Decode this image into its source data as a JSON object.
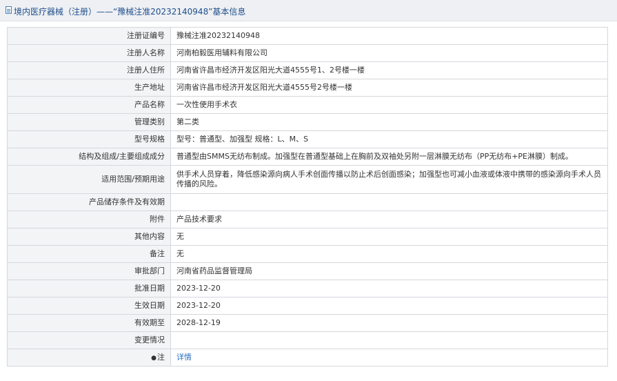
{
  "header": {
    "title": "境内医疗器械（注册）——“豫械注准20232140948”基本信息"
  },
  "rows": [
    {
      "label": "注册证编号",
      "value": "豫械注准20232140948"
    },
    {
      "label": "注册人名称",
      "value": "河南柏毅医用辅料有限公司"
    },
    {
      "label": "注册人住所",
      "value": "河南省许昌市经济开发区阳光大道4555号1、2号楼一楼"
    },
    {
      "label": "生产地址",
      "value": "河南省许昌市经济开发区阳光大道4555号2号楼一楼"
    },
    {
      "label": "产品名称",
      "value": "一次性使用手术衣"
    },
    {
      "label": "管理类别",
      "value": "第二类"
    },
    {
      "label": "型号规格",
      "value": "型号：普通型、加强型 规格：L、M、S"
    },
    {
      "label": "结构及组成/主要组成成分",
      "value": "普通型由SMMS无纺布制成。加强型在普通型基础上在胸前及双袖处另附一层淋膜无纺布（PP无纺布+PE淋膜）制成。"
    },
    {
      "label": "适用范围/预期用途",
      "value": "供手术人员穿着，降低感染源向病人手术创面传播以防止术后创面感染；加强型也可减小血液或体液中携带的感染源向手术人员传播的风险。"
    },
    {
      "label": "产品储存条件及有效期",
      "value": ""
    },
    {
      "label": "附件",
      "value": "产品技术要求"
    },
    {
      "label": "其他内容",
      "value": "无"
    },
    {
      "label": "备注",
      "value": "无"
    },
    {
      "label": "审批部门",
      "value": "河南省药品监督管理局"
    },
    {
      "label": "批准日期",
      "value": "2023-12-20"
    },
    {
      "label": "生效日期",
      "value": "2023-12-20"
    },
    {
      "label": "有效期至",
      "value": "2028-12-19"
    },
    {
      "label": "变更情况",
      "value": ""
    }
  ],
  "note": {
    "bullet": "●",
    "label": "注",
    "link": "详情"
  },
  "colors": {
    "header_bg": "#eef0f3",
    "title_text": "#1f4e8c",
    "label_bg": "#f3f4f6",
    "border": "#d4d7dc",
    "link": "#2a6fbf"
  }
}
